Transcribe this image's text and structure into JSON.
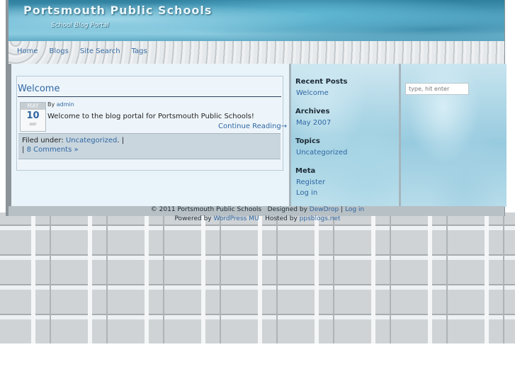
{
  "site": {
    "title": "Portsmouth Public Schools",
    "tagline": "School Blog Portal"
  },
  "nav": [
    {
      "label": "Home"
    },
    {
      "label": "Blogs"
    },
    {
      "label": "Site Search"
    },
    {
      "label": "Tags"
    }
  ],
  "post": {
    "title": "Welcome",
    "date_month": "MAY",
    "date_day": "10",
    "date_year": "2007",
    "byline_prefix": "By",
    "author": "admin",
    "excerpt": "Welcome to the blog portal for Portsmouth Public Schools!",
    "continue_label": "Continue Reading→",
    "filed_prefix": "Filed under:",
    "category": "Uncategorized",
    "filed_suffix": ". |",
    "comments_prefix": "|",
    "comments_label": "8 Comments »"
  },
  "sidebar": {
    "recent_heading": "Recent Posts",
    "recent_items": [
      "Welcome"
    ],
    "archives_heading": "Archives",
    "archives_items": [
      "May 2007"
    ],
    "topics_heading": "Topics",
    "topics_items": [
      "Uncategorized"
    ],
    "meta_heading": "Meta",
    "meta_items": [
      "Register",
      "Log in"
    ]
  },
  "search": {
    "placeholder": "type, hit enter"
  },
  "footer": {
    "copyright": "© 2011 Portsmouth Public Schools",
    "designed_by": "Designed by",
    "designer": "DewDrop",
    "sep": "|",
    "login": "Log in",
    "powered_by": "Powered by",
    "platform": "WordPress MU",
    "hosted_by": "Hosted by",
    "host": "ppsblogs.net"
  }
}
